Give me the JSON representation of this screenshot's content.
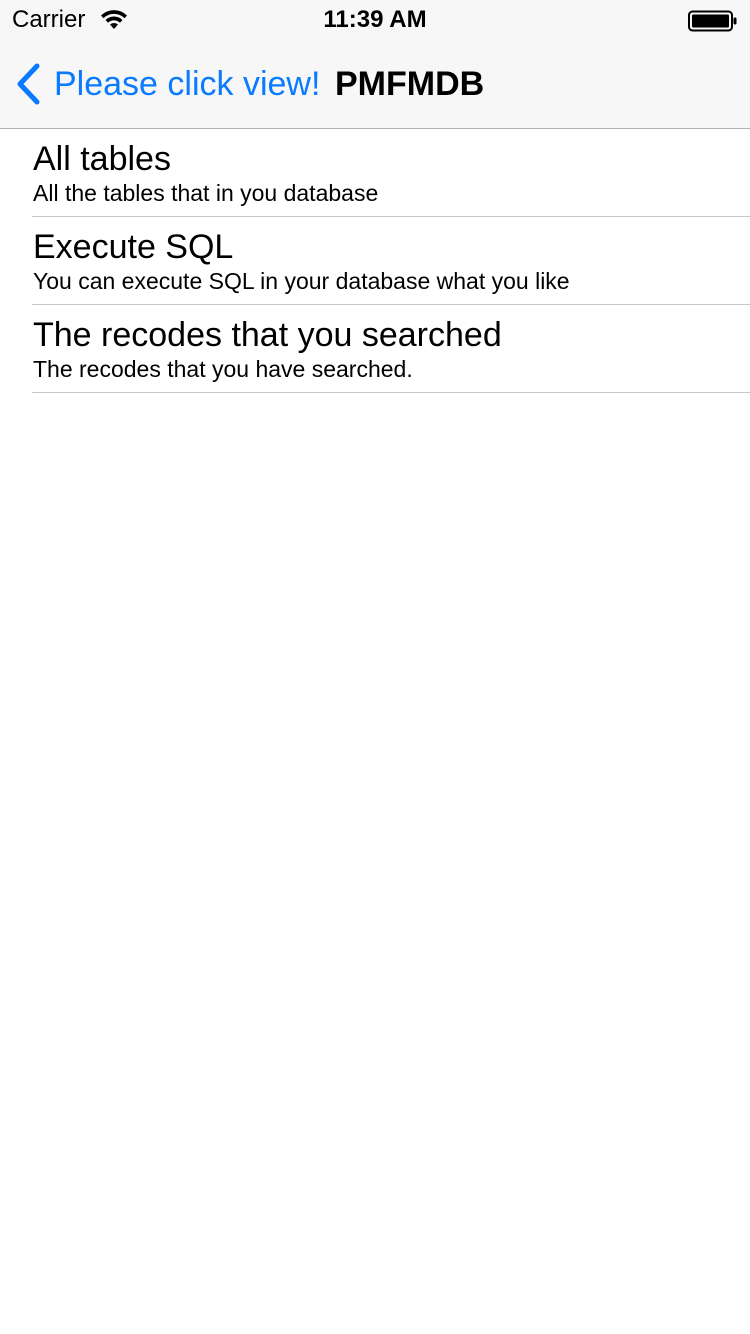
{
  "status_bar": {
    "carrier": "Carrier",
    "time": "11:39 AM",
    "wifi_icon": "wifi-icon",
    "battery_icon": "battery-icon"
  },
  "nav": {
    "back_label": "Please click view!",
    "back_icon": "chevron-left-icon",
    "title": "PMFMDB",
    "tint_color": "#0a7aff"
  },
  "table": {
    "rows": [
      {
        "title": "All tables",
        "subtitle": "All the tables that in you database"
      },
      {
        "title": "Execute SQL",
        "subtitle": "You can execute SQL in your database what you like"
      },
      {
        "title": "The recodes that you searched",
        "subtitle": "The recodes that you have searched."
      }
    ]
  }
}
